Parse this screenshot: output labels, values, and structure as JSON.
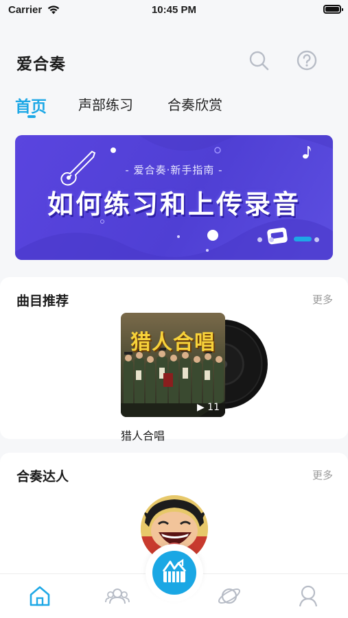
{
  "status_bar": {
    "carrier": "Carrier",
    "time": "10:45 PM"
  },
  "header": {
    "title": "爱合奏",
    "search_icon": "search-icon",
    "help_icon": "help-icon"
  },
  "tabs": [
    {
      "label": "首页",
      "active": true
    },
    {
      "label": "声部练习",
      "active": false
    },
    {
      "label": "合奏欣赏",
      "active": false
    }
  ],
  "banner": {
    "subtitle": "- 爱合奏·新手指南 -",
    "title": "如何练习和上传录音",
    "slides": 3,
    "active_slide": 3
  },
  "recommended": {
    "title": "曲目推荐",
    "more": "更多",
    "songs": [
      {
        "name": "猎人合唱",
        "cover_text": "猎人合唱",
        "play_count": "▶ 11"
      }
    ]
  },
  "masters": {
    "title": "合奏达人",
    "more": "更多"
  },
  "tabbar": {
    "items": [
      "home-icon",
      "community-icon",
      "record-center-icon",
      "discover-planet-icon",
      "profile-icon"
    ],
    "active": "home-icon"
  },
  "colors": {
    "accent": "#1ea8e6",
    "banner": "#5a45df",
    "background": "#f6f7f9"
  }
}
